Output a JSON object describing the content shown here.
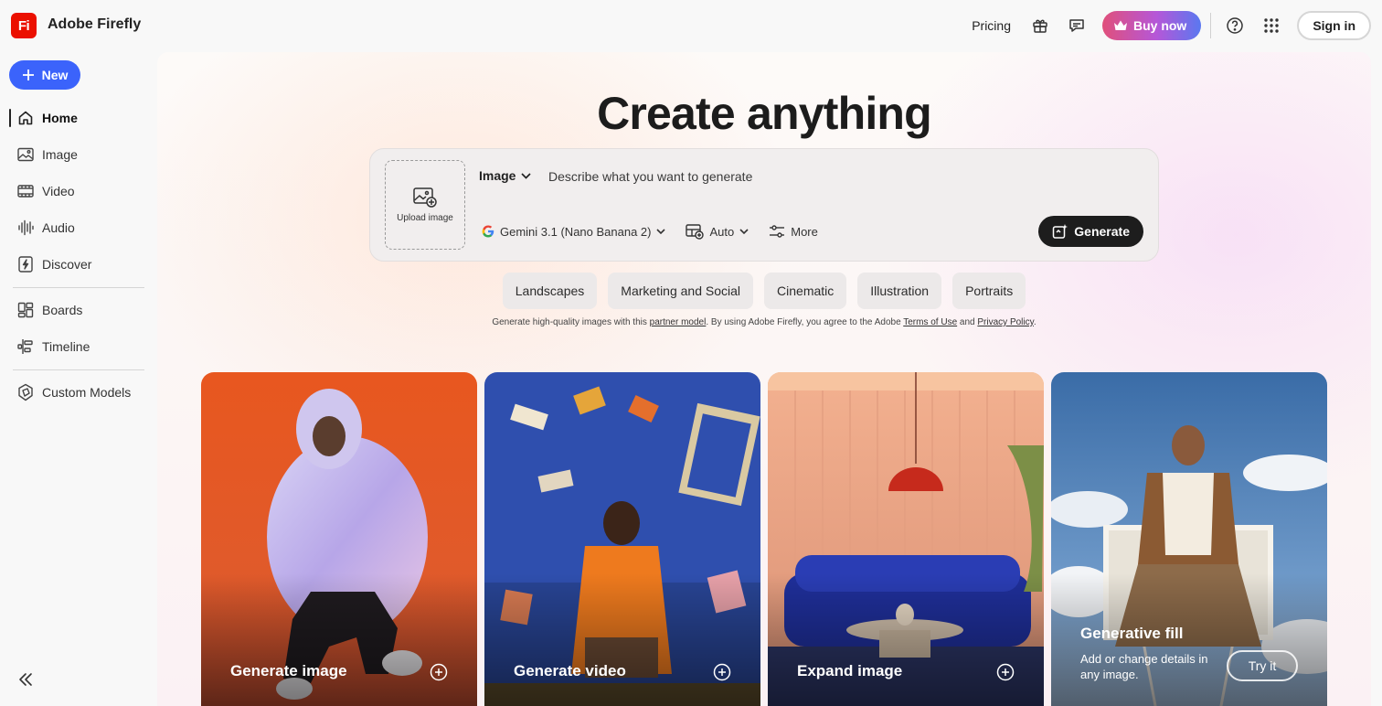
{
  "app": {
    "logo_text": "Fi",
    "title": "Adobe Firefly"
  },
  "header": {
    "pricing": "Pricing",
    "buy_now": "Buy now",
    "sign_in": "Sign in",
    "icons": [
      "gift-icon",
      "chat-icon",
      "help-icon",
      "apps-grid-icon"
    ]
  },
  "sidebar": {
    "new_label": "New",
    "items": [
      {
        "label": "Home",
        "icon": "home-icon",
        "active": true
      },
      {
        "label": "Image",
        "icon": "image-icon"
      },
      {
        "label": "Video",
        "icon": "video-icon"
      },
      {
        "label": "Audio",
        "icon": "audio-icon"
      },
      {
        "label": "Discover",
        "icon": "discover-icon"
      },
      {
        "label": "Boards",
        "icon": "boards-icon"
      },
      {
        "label": "Timeline",
        "icon": "timeline-icon"
      },
      {
        "label": "Custom Models",
        "icon": "custom-models-icon"
      }
    ]
  },
  "main": {
    "headline": "Create anything",
    "prompt": {
      "upload_label": "Upload image",
      "type": "Image",
      "placeholder": "Describe what you want to generate",
      "model": "Gemini 3.1 (Nano Banana 2)",
      "aspect": "Auto",
      "more": "More",
      "generate": "Generate"
    },
    "chips": [
      "Landscapes",
      "Marketing and Social",
      "Cinematic",
      "Illustration",
      "Portraits"
    ],
    "disclaimer": {
      "part1": "Generate high-quality images with this ",
      "partner_link": "partner model",
      "part2": ". By using Adobe Firefly, you agree to the Adobe ",
      "terms_link": "Terms of Use",
      "part3": " and ",
      "privacy_link": "Privacy Policy",
      "part4": "."
    },
    "cards": [
      {
        "title": "Generate image"
      },
      {
        "title": "Generate video"
      },
      {
        "title": "Expand image"
      },
      {
        "title": "Generative fill",
        "description": "Add or change details in any image.",
        "button": "Try it"
      }
    ]
  },
  "colors": {
    "accent_blue": "#3b63fb",
    "brand_red": "#eb1000",
    "generate_black": "#1d1d1d"
  }
}
